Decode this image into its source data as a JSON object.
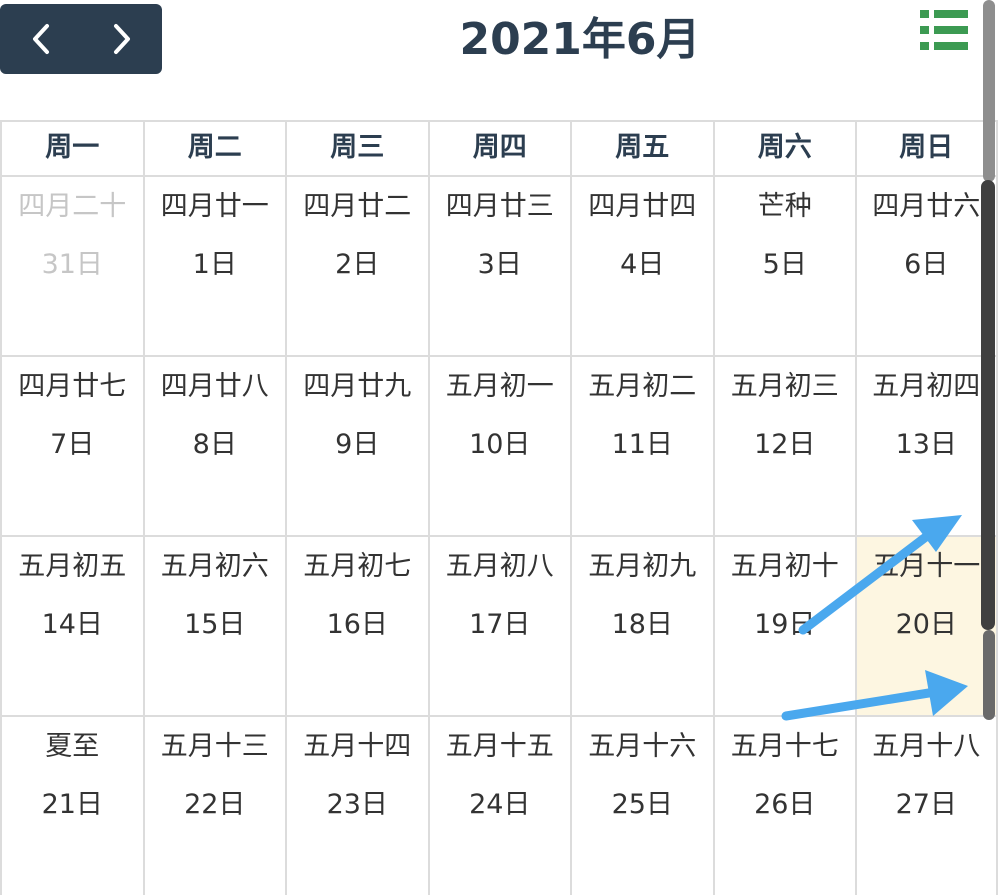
{
  "header": {
    "title": "2021年6月",
    "prev_icon": "chevron-left-icon",
    "next_icon": "chevron-right-icon",
    "list_icon": "list-icon"
  },
  "weekdays": [
    "周一",
    "周二",
    "周三",
    "周四",
    "周五",
    "周六",
    "周日"
  ],
  "weeks": [
    [
      {
        "lunar": "四月二十",
        "solar": "31日",
        "other_month": true
      },
      {
        "lunar": "四月廿一",
        "solar": "1日"
      },
      {
        "lunar": "四月廿二",
        "solar": "2日"
      },
      {
        "lunar": "四月廿三",
        "solar": "3日"
      },
      {
        "lunar": "四月廿四",
        "solar": "4日"
      },
      {
        "lunar": "芒种",
        "solar": "5日"
      },
      {
        "lunar": "四月廿六",
        "solar": "6日"
      }
    ],
    [
      {
        "lunar": "四月廿七",
        "solar": "7日"
      },
      {
        "lunar": "四月廿八",
        "solar": "8日"
      },
      {
        "lunar": "四月廿九",
        "solar": "9日"
      },
      {
        "lunar": "五月初一",
        "solar": "10日"
      },
      {
        "lunar": "五月初二",
        "solar": "11日"
      },
      {
        "lunar": "五月初三",
        "solar": "12日"
      },
      {
        "lunar": "五月初四",
        "solar": "13日"
      }
    ],
    [
      {
        "lunar": "五月初五",
        "solar": "14日"
      },
      {
        "lunar": "五月初六",
        "solar": "15日"
      },
      {
        "lunar": "五月初七",
        "solar": "16日"
      },
      {
        "lunar": "五月初八",
        "solar": "17日"
      },
      {
        "lunar": "五月初九",
        "solar": "18日"
      },
      {
        "lunar": "五月初十",
        "solar": "19日"
      },
      {
        "lunar": "五月十一",
        "solar": "20日",
        "today": true
      }
    ],
    [
      {
        "lunar": "夏至",
        "solar": "21日"
      },
      {
        "lunar": "五月十三",
        "solar": "22日"
      },
      {
        "lunar": "五月十四",
        "solar": "23日"
      },
      {
        "lunar": "五月十五",
        "solar": "24日"
      },
      {
        "lunar": "五月十六",
        "solar": "25日"
      },
      {
        "lunar": "五月十七",
        "solar": "26日"
      },
      {
        "lunar": "五月十八",
        "solar": "27日"
      }
    ]
  ],
  "colors": {
    "nav_bg": "#2c3e50",
    "title": "#2c3e50",
    "list_icon": "#3c9a52",
    "today_bg": "#fdf6e1",
    "other_month_text": "#c6c6c6",
    "annotation_arrow": "#4aa8ee"
  }
}
